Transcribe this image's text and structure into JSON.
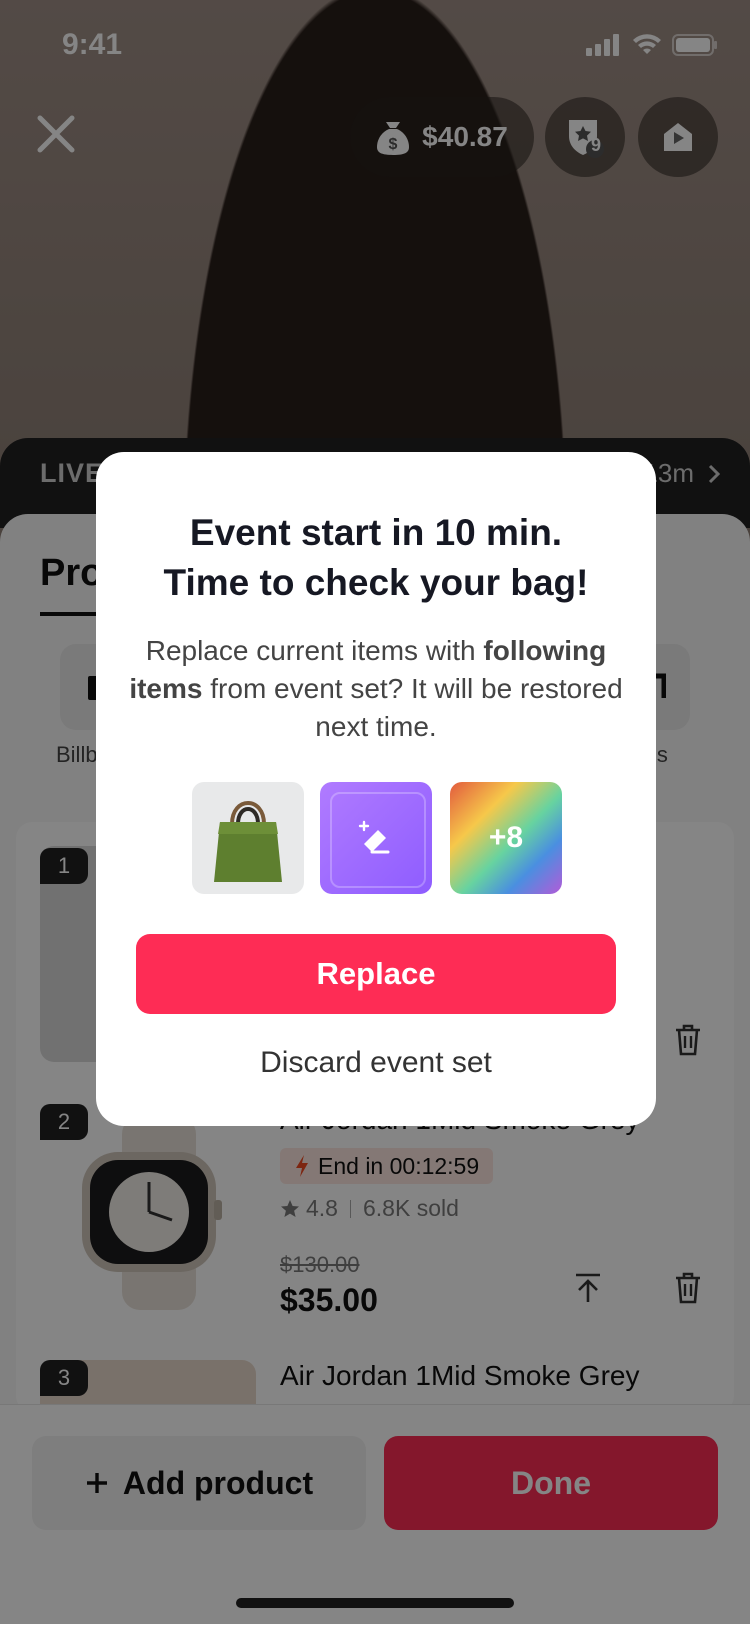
{
  "status_bar": {
    "time": "9:41"
  },
  "top_bar": {
    "balance": "$40.87",
    "badge_count": "9"
  },
  "live_strip": {
    "label": "LIVE",
    "time": "13m"
  },
  "sheet": {
    "tab_title": "Pro",
    "tools": [
      {
        "label": "Billb"
      },
      {
        "label": "ls"
      }
    ]
  },
  "products": [
    {
      "index": "1"
    },
    {
      "index": "2",
      "title": "Air Jordan 1Mid Smoke Grey",
      "flash": "End in 00:12:59",
      "rating": "4.8",
      "sold": "6.8K sold",
      "price_old": "$130.00",
      "price_new": "$35.00"
    },
    {
      "index": "3",
      "title": "Air Jordan 1Mid Smoke Grey"
    }
  ],
  "bottom_bar": {
    "add_label": "Add product",
    "done_label": "Done"
  },
  "modal": {
    "title_line1": "Event start in 10 min.",
    "title_line2": "Time to check your bag!",
    "body_prefix": "Replace current items with",
    "body_bold": "following items",
    "body_suffix": "from event set? It will be restored next time.",
    "more_count": "+8",
    "replace_label": "Replace",
    "discard_label": "Discard event set"
  },
  "colors": {
    "accent": "#fe2c55",
    "flash_bg": "#fde7e1",
    "voucher": "#9a66ff"
  }
}
